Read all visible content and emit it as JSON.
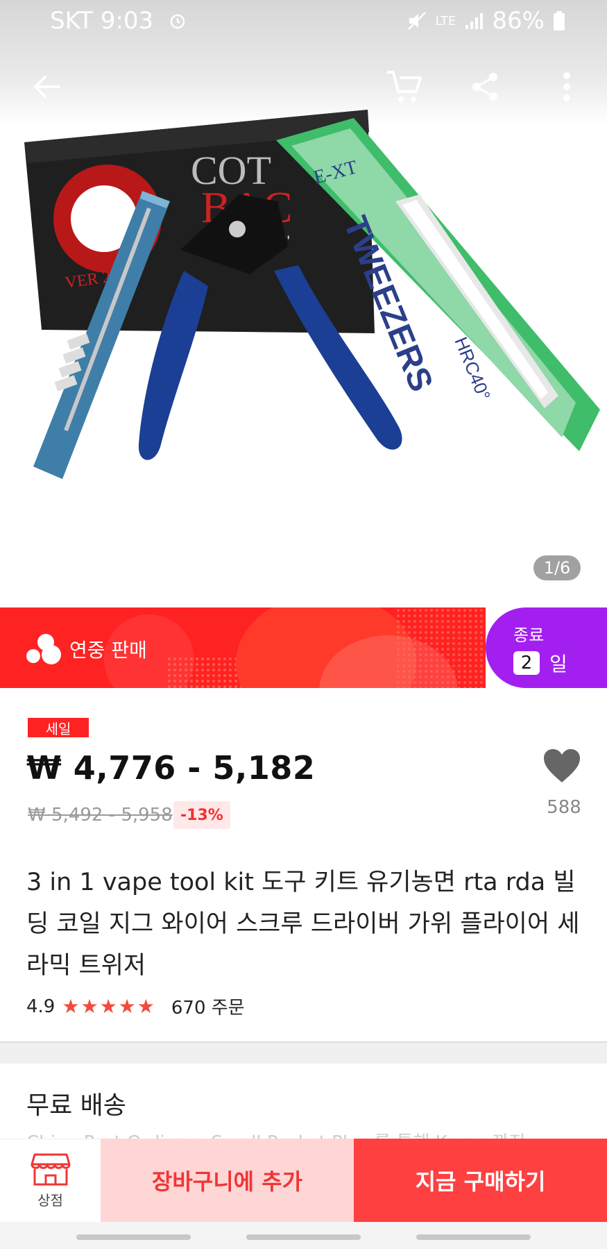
{
  "status_bar": {
    "carrier_time": "SKT 9:03",
    "network": "LTE",
    "battery": "86%"
  },
  "image": {
    "counter": "1/6"
  },
  "promo": {
    "label": "연중 판매",
    "end_label": "종료",
    "days_value": "2",
    "days_unit": "일"
  },
  "product": {
    "sale_badge": "세일",
    "price": "₩ 4,776 - 5,182",
    "old_price": "₩ 5,492 - 5,958",
    "discount": "-13%",
    "wish_count": "588",
    "title": "3 in 1 vape tool kit 도구 키트 유기농면 rta rda 빌딩 코일 지그 와이어 스크루 드라이버 가위 플라이어 세라믹 트위저",
    "rating": "4.9",
    "stars": "★★★★★",
    "orders": "670 주문"
  },
  "shipping": {
    "title": "무료 배송",
    "sub": "China Post Ordinary Small Packet Plus 를 통해 Korea 까지"
  },
  "bottom_bar": {
    "store_label": "상점",
    "cart_label": "장바구니에 추가",
    "buy_label": "지금 구매하기"
  },
  "icons": {
    "back": "back-arrow-icon",
    "cart": "cart-icon",
    "share": "share-icon",
    "more": "more-vertical-icon",
    "heart": "heart-icon",
    "store": "store-icon"
  },
  "colors": {
    "accent_red": "#ff2222",
    "purple": "#a31ff0",
    "cart_bg": "#ffd6d6",
    "buy_bg": "#ff4040"
  }
}
